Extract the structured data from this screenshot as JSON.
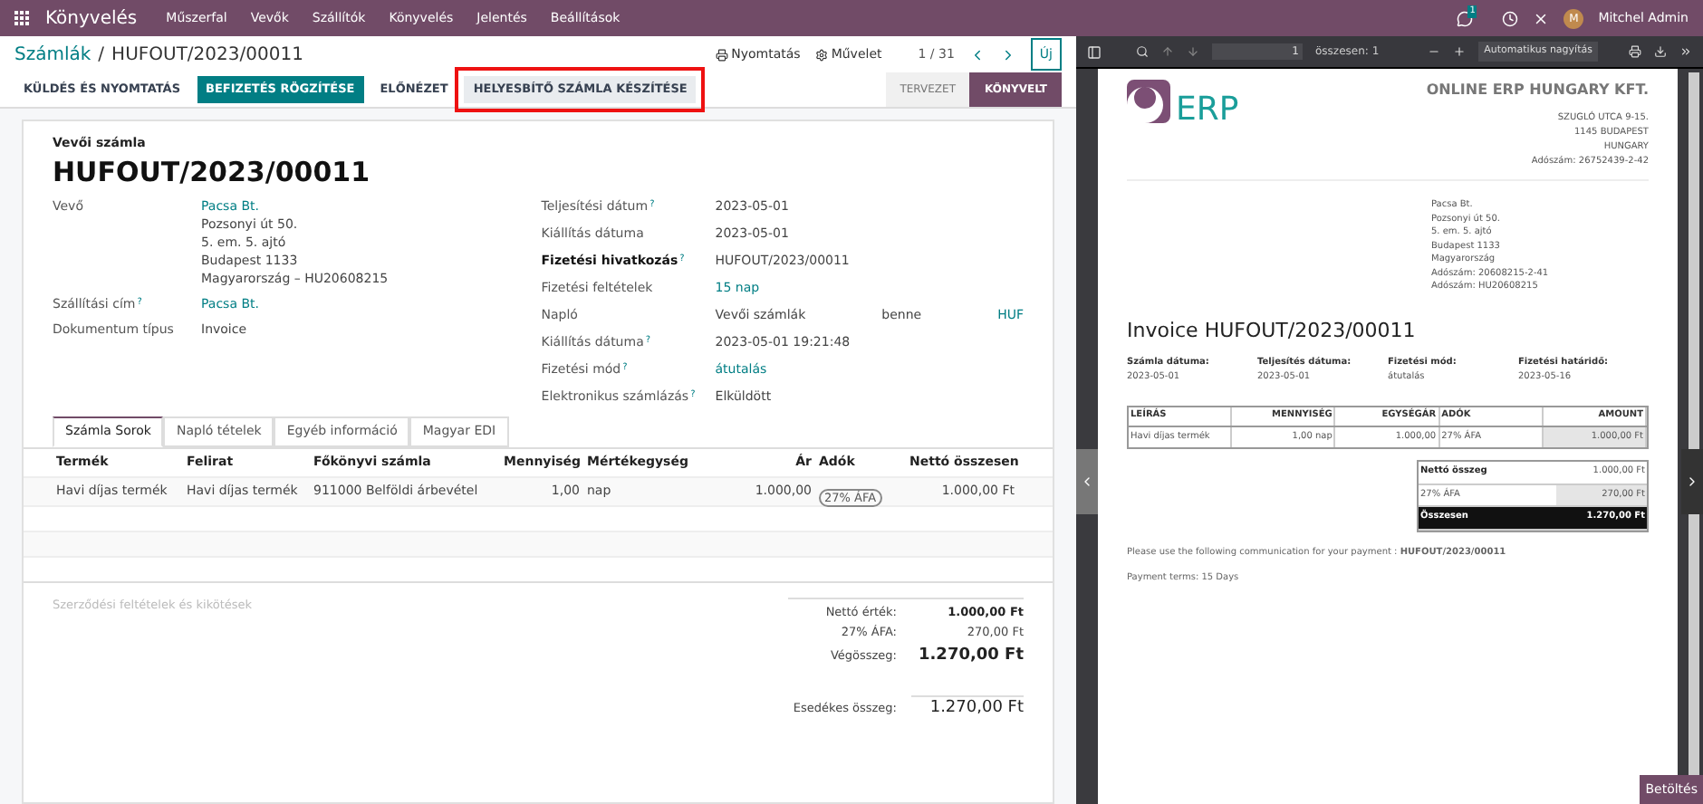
{
  "topbar": {
    "app": "Könyvelés",
    "menu": [
      "Műszerfal",
      "Vevők",
      "Szállítók",
      "Könyvelés",
      "Jelentés",
      "Beállítások"
    ],
    "chat_count": "1",
    "user_initial": "M",
    "user": "Mitchel Admin"
  },
  "breadcrumb": {
    "parent": "Számlák",
    "separator": "/",
    "current": "HUFOUT/2023/00011"
  },
  "actions": {
    "print": "Nyomtatás",
    "action": "Művelet",
    "pager": "1 / 31",
    "new": "Új"
  },
  "buttons": [
    {
      "label": "KÜLDÉS ÉS NYOMTATÁS",
      "kind": "plain",
      "highlighted": false
    },
    {
      "label": "BEFIZETÉS RÖGZÍTÉSE",
      "kind": "primary",
      "highlighted": false
    },
    {
      "label": "ELŐNÉZET",
      "kind": "plain",
      "highlighted": false
    },
    {
      "label": "HELYESBÍTŐ SZÁMLA KÉSZÍTÉSE",
      "kind": "secondary",
      "highlighted": true
    }
  ],
  "status": [
    {
      "label": "TERVEZET",
      "selected": false
    },
    {
      "label": "KÖNYVELT",
      "selected": true
    }
  ],
  "form": {
    "subtitle": "Vevői számla",
    "title": "HUFOUT/2023/00011",
    "left_fields": [
      {
        "label": "Vevő",
        "bold": false,
        "values": [
          {
            "text": "Pacsa Bt.",
            "link": true
          },
          {
            "text": "Pozsonyi út 50.",
            "link": false
          },
          {
            "text": "5. em. 5. ajtó",
            "link": false
          },
          {
            "text": "Budapest 1133",
            "link": false
          },
          {
            "text": "Magyarország – HU20608215",
            "link": false
          }
        ]
      },
      {
        "label": "Szállítási cím",
        "help": "?",
        "bold": false,
        "values": [
          {
            "text": "Pacsa Bt.",
            "link": true
          }
        ]
      },
      {
        "label": "Dokumentum típus",
        "bold": false,
        "values": [
          {
            "text": "Invoice",
            "link": false
          }
        ]
      }
    ],
    "right_fields": [
      {
        "label": "Teljesítési dátum",
        "help": "?",
        "bold": false,
        "values": [
          {
            "text": "2023-05-01",
            "link": false
          }
        ]
      },
      {
        "label": "Kiállítás dátuma",
        "bold": false,
        "values": [
          {
            "text": "2023-05-01",
            "link": false
          }
        ]
      },
      {
        "label": "Fizetési hivatkozás",
        "help": "?",
        "bold": true,
        "values": [
          {
            "text": "HUFOUT/2023/00011",
            "link": false
          }
        ]
      },
      {
        "label": "Fizetési feltételek",
        "bold": false,
        "values": [
          {
            "text": "15 nap",
            "link": true
          }
        ]
      },
      {
        "label": "Napló",
        "bold": false,
        "values": [
          {
            "text": "Vevői számlák",
            "link": false
          },
          {
            "text": "benne",
            "link": false
          },
          {
            "text": "HUF",
            "link": true
          }
        ]
      },
      {
        "label": "Kiállítás dátuma",
        "help": "?",
        "bold": false,
        "values": [
          {
            "text": "2023-05-01 19:21:48",
            "link": false
          }
        ]
      },
      {
        "label": "Fizetési mód",
        "help": "?",
        "bold": false,
        "values": [
          {
            "text": "átutalás",
            "link": true
          }
        ]
      },
      {
        "label": "Elektronikus számlázás",
        "help": "?",
        "bold": false,
        "values": [
          {
            "text": "Elküldött",
            "link": false
          }
        ]
      }
    ]
  },
  "tabs": [
    {
      "label": "Számla Sorok",
      "selected": true
    },
    {
      "label": "Napló tételek",
      "selected": false
    },
    {
      "label": "Egyéb információ",
      "selected": false
    },
    {
      "label": "Magyar EDI",
      "selected": false
    }
  ],
  "table": {
    "columns": [
      {
        "label": "Termék",
        "kind": "text"
      },
      {
        "label": "Felirat",
        "kind": "text"
      },
      {
        "label": "Főkönyvi számla",
        "kind": "text"
      },
      {
        "label": "Mennyiség",
        "kind": "number"
      },
      {
        "label": "Mértékegység",
        "kind": "text"
      },
      {
        "label": "Ár",
        "kind": "number"
      },
      {
        "label": "Adók",
        "kind": "tag"
      },
      {
        "label": "Nettó összesen",
        "kind": "number"
      }
    ],
    "rows": [
      [
        "Havi díjas termék",
        "Havi díjas termék",
        "911000 Belföldi árbevétel",
        "1,00",
        "nap",
        "1.000,00",
        "27% ÁFA",
        "1.000,00 Ft"
      ]
    ]
  },
  "terms_placeholder": "Szerződési feltételek és kikötések",
  "totals": [
    {
      "label": "Nettó érték:",
      "value": "1.000,00 Ft",
      "kind": "bold"
    },
    {
      "label": "27% ÁFA:",
      "value": "270,00 Ft",
      "kind": "normal"
    },
    {
      "label": "Végösszeg:",
      "value": "1.270,00 Ft",
      "kind": "total"
    }
  ],
  "due": {
    "label": "Esedékes összeg:",
    "value": "1.270,00 Ft"
  },
  "pdf": {
    "page": "1",
    "page_total": "összesen: 1",
    "zoom": "Automatikus nagyítás",
    "logo_text": "ERP",
    "company": "ONLINE ERP HUNGARY KFT.",
    "company_address": [
      "SZUGLÓ UTCA 9-15.",
      "1145 BUDAPEST",
      "HUNGARY",
      "Adószám: 26752439-2-42"
    ],
    "customer": [
      "Pacsa Bt.",
      "Pozsonyi út 50.",
      "5. em. 5. ajtó",
      "Budapest 1133",
      "Magyarország",
      "Adószám: 20608215-2-41",
      "Adószám: HU20608215"
    ],
    "title": "Invoice HUFOUT/2023/00011",
    "info": [
      {
        "label": "Számla dátuma:",
        "value": "2023-05-01"
      },
      {
        "label": "Teljesítés dátuma:",
        "value": "2023-05-01"
      },
      {
        "label": "Fizetési mód:",
        "value": "átutalás"
      },
      {
        "label": "Fizetési határidő:",
        "value": "2023-05-16"
      }
    ],
    "columns": [
      {
        "label": "LEÍRÁS",
        "kind": "text"
      },
      {
        "label": "MENNYISÉG",
        "kind": "number"
      },
      {
        "label": "EGYSÉGÁR",
        "kind": "number"
      },
      {
        "label": "ADÓK",
        "kind": "text"
      },
      {
        "label": "AMOUNT",
        "kind": "amount"
      }
    ],
    "rows": [
      [
        "Havi díjas termék",
        "1,00 nap",
        "1.000,00",
        "27% ÁFA",
        "1.000,00 Ft"
      ]
    ],
    "totals": [
      {
        "label": "Nettó összeg",
        "value": "1.000,00 Ft",
        "kind": "subtotal"
      },
      {
        "label": "27% ÁFA",
        "value": "270,00 Ft",
        "kind": "tax"
      },
      {
        "label": "Összesen",
        "value": "1.270,00 Ft",
        "kind": "total"
      }
    ],
    "communication": "Please use the following communication for your payment : **HUFOUT/2023/00011**",
    "payment_terms": "Payment terms: 15 Days"
  },
  "load_button": "Betöltés"
}
